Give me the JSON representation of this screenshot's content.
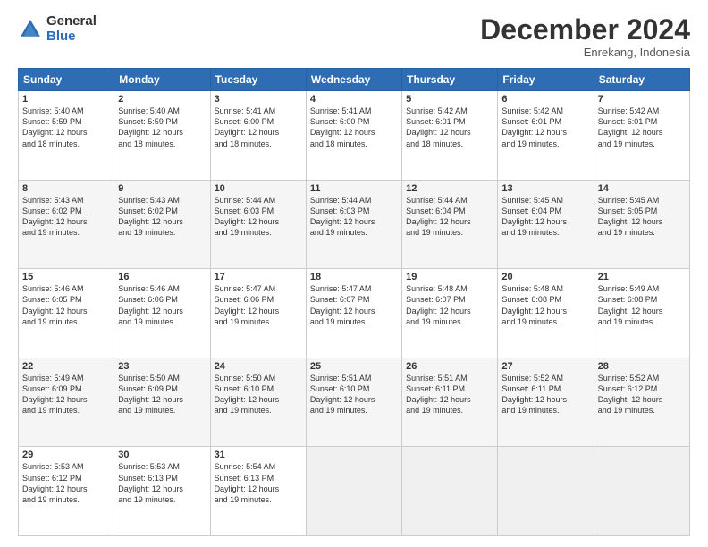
{
  "logo": {
    "general": "General",
    "blue": "Blue"
  },
  "header": {
    "month": "December 2024",
    "location": "Enrekang, Indonesia"
  },
  "days_of_week": [
    "Sunday",
    "Monday",
    "Tuesday",
    "Wednesday",
    "Thursday",
    "Friday",
    "Saturday"
  ],
  "weeks": [
    [
      {
        "day": "1",
        "info": "Sunrise: 5:40 AM\nSunset: 5:59 PM\nDaylight: 12 hours\nand 18 minutes."
      },
      {
        "day": "2",
        "info": "Sunrise: 5:40 AM\nSunset: 5:59 PM\nDaylight: 12 hours\nand 18 minutes."
      },
      {
        "day": "3",
        "info": "Sunrise: 5:41 AM\nSunset: 6:00 PM\nDaylight: 12 hours\nand 18 minutes."
      },
      {
        "day": "4",
        "info": "Sunrise: 5:41 AM\nSunset: 6:00 PM\nDaylight: 12 hours\nand 18 minutes."
      },
      {
        "day": "5",
        "info": "Sunrise: 5:42 AM\nSunset: 6:01 PM\nDaylight: 12 hours\nand 18 minutes."
      },
      {
        "day": "6",
        "info": "Sunrise: 5:42 AM\nSunset: 6:01 PM\nDaylight: 12 hours\nand 19 minutes."
      },
      {
        "day": "7",
        "info": "Sunrise: 5:42 AM\nSunset: 6:01 PM\nDaylight: 12 hours\nand 19 minutes."
      }
    ],
    [
      {
        "day": "8",
        "info": "Sunrise: 5:43 AM\nSunset: 6:02 PM\nDaylight: 12 hours\nand 19 minutes."
      },
      {
        "day": "9",
        "info": "Sunrise: 5:43 AM\nSunset: 6:02 PM\nDaylight: 12 hours\nand 19 minutes."
      },
      {
        "day": "10",
        "info": "Sunrise: 5:44 AM\nSunset: 6:03 PM\nDaylight: 12 hours\nand 19 minutes."
      },
      {
        "day": "11",
        "info": "Sunrise: 5:44 AM\nSunset: 6:03 PM\nDaylight: 12 hours\nand 19 minutes."
      },
      {
        "day": "12",
        "info": "Sunrise: 5:44 AM\nSunset: 6:04 PM\nDaylight: 12 hours\nand 19 minutes."
      },
      {
        "day": "13",
        "info": "Sunrise: 5:45 AM\nSunset: 6:04 PM\nDaylight: 12 hours\nand 19 minutes."
      },
      {
        "day": "14",
        "info": "Sunrise: 5:45 AM\nSunset: 6:05 PM\nDaylight: 12 hours\nand 19 minutes."
      }
    ],
    [
      {
        "day": "15",
        "info": "Sunrise: 5:46 AM\nSunset: 6:05 PM\nDaylight: 12 hours\nand 19 minutes."
      },
      {
        "day": "16",
        "info": "Sunrise: 5:46 AM\nSunset: 6:06 PM\nDaylight: 12 hours\nand 19 minutes."
      },
      {
        "day": "17",
        "info": "Sunrise: 5:47 AM\nSunset: 6:06 PM\nDaylight: 12 hours\nand 19 minutes."
      },
      {
        "day": "18",
        "info": "Sunrise: 5:47 AM\nSunset: 6:07 PM\nDaylight: 12 hours\nand 19 minutes."
      },
      {
        "day": "19",
        "info": "Sunrise: 5:48 AM\nSunset: 6:07 PM\nDaylight: 12 hours\nand 19 minutes."
      },
      {
        "day": "20",
        "info": "Sunrise: 5:48 AM\nSunset: 6:08 PM\nDaylight: 12 hours\nand 19 minutes."
      },
      {
        "day": "21",
        "info": "Sunrise: 5:49 AM\nSunset: 6:08 PM\nDaylight: 12 hours\nand 19 minutes."
      }
    ],
    [
      {
        "day": "22",
        "info": "Sunrise: 5:49 AM\nSunset: 6:09 PM\nDaylight: 12 hours\nand 19 minutes."
      },
      {
        "day": "23",
        "info": "Sunrise: 5:50 AM\nSunset: 6:09 PM\nDaylight: 12 hours\nand 19 minutes."
      },
      {
        "day": "24",
        "info": "Sunrise: 5:50 AM\nSunset: 6:10 PM\nDaylight: 12 hours\nand 19 minutes."
      },
      {
        "day": "25",
        "info": "Sunrise: 5:51 AM\nSunset: 6:10 PM\nDaylight: 12 hours\nand 19 minutes."
      },
      {
        "day": "26",
        "info": "Sunrise: 5:51 AM\nSunset: 6:11 PM\nDaylight: 12 hours\nand 19 minutes."
      },
      {
        "day": "27",
        "info": "Sunrise: 5:52 AM\nSunset: 6:11 PM\nDaylight: 12 hours\nand 19 minutes."
      },
      {
        "day": "28",
        "info": "Sunrise: 5:52 AM\nSunset: 6:12 PM\nDaylight: 12 hours\nand 19 minutes."
      }
    ],
    [
      {
        "day": "29",
        "info": "Sunrise: 5:53 AM\nSunset: 6:12 PM\nDaylight: 12 hours\nand 19 minutes."
      },
      {
        "day": "30",
        "info": "Sunrise: 5:53 AM\nSunset: 6:13 PM\nDaylight: 12 hours\nand 19 minutes."
      },
      {
        "day": "31",
        "info": "Sunrise: 5:54 AM\nSunset: 6:13 PM\nDaylight: 12 hours\nand 19 minutes."
      },
      null,
      null,
      null,
      null
    ]
  ]
}
